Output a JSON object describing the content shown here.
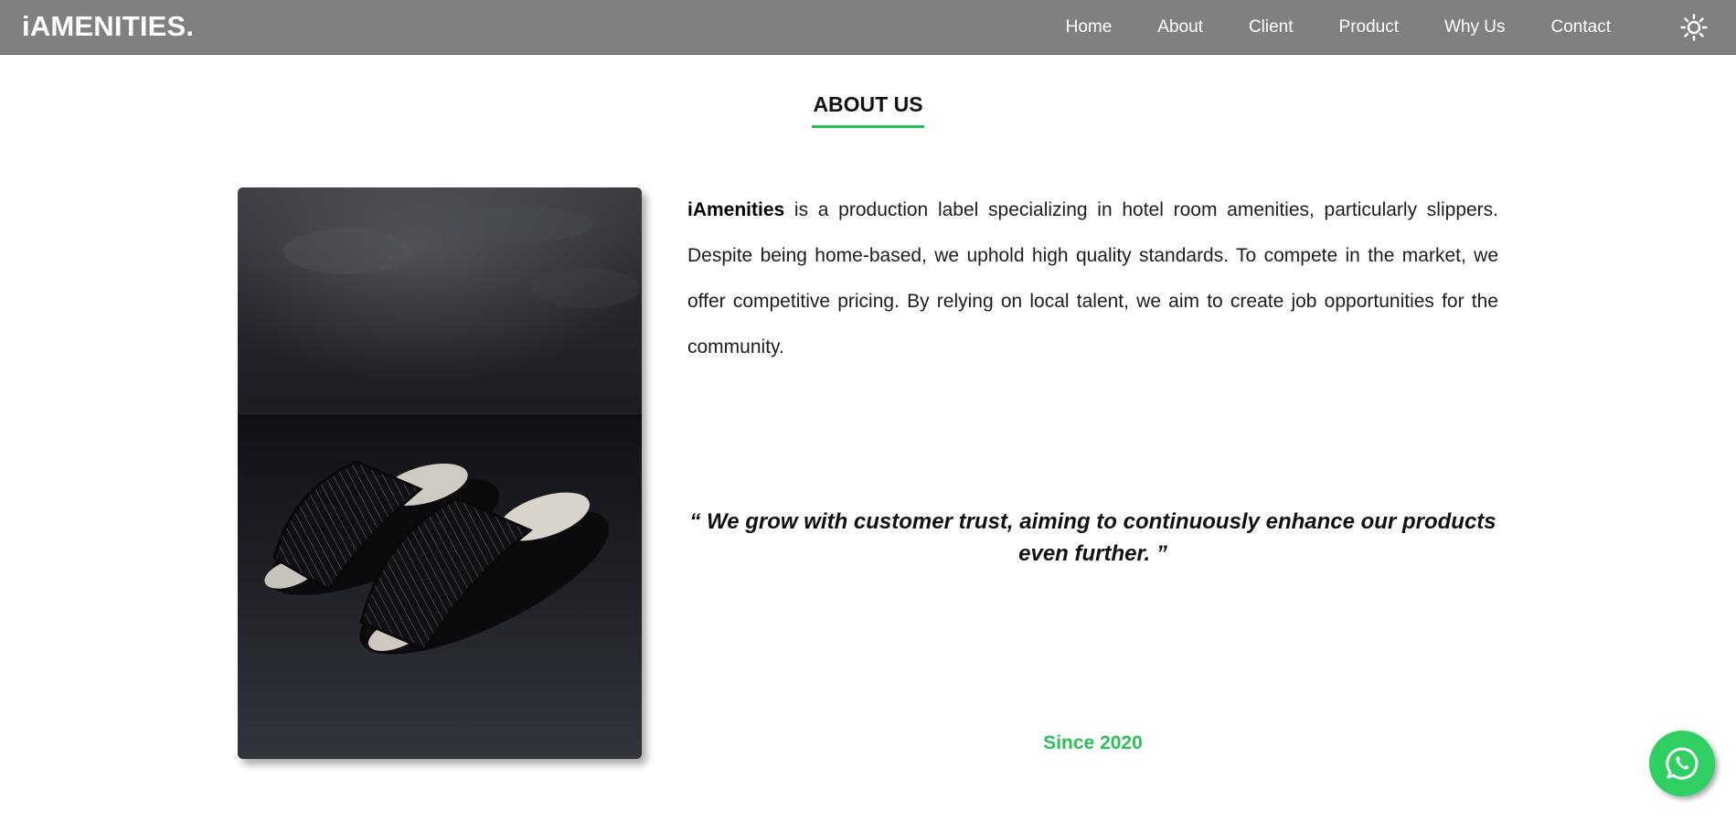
{
  "brand": {
    "name": "iAMENITIES."
  },
  "nav": {
    "items": [
      {
        "label": "Home"
      },
      {
        "label": "About"
      },
      {
        "label": "Client"
      },
      {
        "label": "Product"
      },
      {
        "label": "Why Us"
      },
      {
        "label": "Contact"
      }
    ],
    "theme_toggle_icon": "sun-icon"
  },
  "about": {
    "title": "ABOUT US",
    "description_bold": "iAmenities",
    "description_rest": " is a production label specializing in hotel room amenities, particularly slippers. Despite being home-based, we uphold high quality standards. To compete in the market, we offer competitive pricing. By relying on local talent, we aim to create job opportunities for the community.",
    "quote": "“ We grow with customer trust, aiming to continuously enhance our products even further. ”",
    "since": "Since 2020",
    "image_subject": "pair-of-dark-striped-slippers-photo"
  },
  "fab": {
    "icon": "whatsapp-icon"
  },
  "colors": {
    "navbar": "#808080",
    "accent": "#2bbf5a",
    "whatsapp": "#2fcf62"
  }
}
